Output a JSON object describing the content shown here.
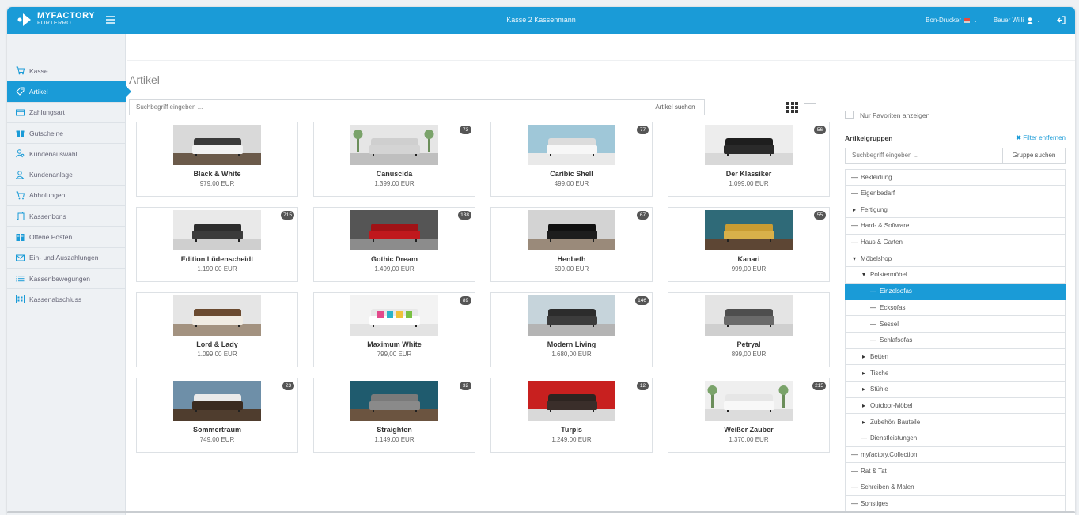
{
  "header": {
    "logo_main": "MYFACTORY",
    "logo_sub": "FORTERRO",
    "title": "Kasse 2 Kassenmann",
    "printer": "Bon-Drucker",
    "user": "Bauer Willi"
  },
  "sidebar": {
    "items": [
      {
        "label": "Kasse",
        "icon": "cart-icon",
        "active": false
      },
      {
        "label": "Artikel",
        "icon": "tag-icon",
        "active": true
      },
      {
        "label": "Zahlungsart",
        "icon": "credit-card-icon",
        "active": false
      },
      {
        "label": "Gutscheine",
        "icon": "gift-icon",
        "active": false
      },
      {
        "label": "Kundenauswahl",
        "icon": "user-search-icon",
        "active": false
      },
      {
        "label": "Kundenanlage",
        "icon": "user-add-icon",
        "active": false
      },
      {
        "label": "Abholungen",
        "icon": "pickup-cart-icon",
        "active": false
      },
      {
        "label": "Kassenbons",
        "icon": "receipt-icon",
        "active": false
      },
      {
        "label": "Offene Posten",
        "icon": "ledger-icon",
        "active": false
      },
      {
        "label": "Ein- und Auszahlungen",
        "icon": "envelope-icon",
        "active": false
      },
      {
        "label": "Kassenbewegungen",
        "icon": "list-icon",
        "active": false
      },
      {
        "label": "Kassenabschluss",
        "icon": "calculator-icon",
        "active": false
      }
    ]
  },
  "main": {
    "title": "Artikel",
    "search_placeholder": "Suchbegriff eingeben ...",
    "search_button": "Artikel suchen"
  },
  "products": [
    {
      "name": "Black & White",
      "price": "979,00 EUR",
      "badge": ""
    },
    {
      "name": "Canuscida",
      "price": "1.399,00 EUR",
      "badge": "73"
    },
    {
      "name": "Caribic Shell",
      "price": "499,00 EUR",
      "badge": "77"
    },
    {
      "name": "Der Klassiker",
      "price": "1.099,00 EUR",
      "badge": "56"
    },
    {
      "name": "Edition Lüdenscheidt",
      "price": "1.199,00 EUR",
      "badge": "715"
    },
    {
      "name": "Gothic Dream",
      "price": "1.499,00 EUR",
      "badge": "138"
    },
    {
      "name": "Henbeth",
      "price": "699,00 EUR",
      "badge": "67"
    },
    {
      "name": "Kanari",
      "price": "999,00 EUR",
      "badge": "55"
    },
    {
      "name": "Lord & Lady",
      "price": "1.099,00 EUR",
      "badge": ""
    },
    {
      "name": "Maximum White",
      "price": "799,00 EUR",
      "badge": "89"
    },
    {
      "name": "Modern Living",
      "price": "1.680,00 EUR",
      "badge": "146"
    },
    {
      "name": "Petryal",
      "price": "899,00 EUR",
      "badge": ""
    },
    {
      "name": "Sommertraum",
      "price": "749,00 EUR",
      "badge": "23"
    },
    {
      "name": "Straighten",
      "price": "1.149,00 EUR",
      "badge": "32"
    },
    {
      "name": "Turpis",
      "price": "1.249,00 EUR",
      "badge": "12"
    },
    {
      "name": "Weißer Zauber",
      "price": "1.370,00 EUR",
      "badge": "215"
    }
  ],
  "right_panel": {
    "favorites_label": "Nur Favoriten anzeigen",
    "groups_title": "Artikelgruppen",
    "filter_remove": "Filter entfernen",
    "group_search_placeholder": "Suchbegriff eingeben ...",
    "group_search_button": "Gruppe suchen",
    "tree": [
      {
        "label": "Bekleidung",
        "level": 0,
        "state": "leaf"
      },
      {
        "label": "Eigenbedarf",
        "level": 0,
        "state": "leaf"
      },
      {
        "label": "Fertigung",
        "level": 0,
        "state": "collapsed"
      },
      {
        "label": "Hard- & Software",
        "level": 0,
        "state": "leaf"
      },
      {
        "label": "Haus & Garten",
        "level": 0,
        "state": "leaf"
      },
      {
        "label": "Möbelshop",
        "level": 0,
        "state": "expanded"
      },
      {
        "label": "Polstermöbel",
        "level": 1,
        "state": "expanded"
      },
      {
        "label": "Einzelsofas",
        "level": 2,
        "state": "leaf",
        "selected": true
      },
      {
        "label": "Ecksofas",
        "level": 2,
        "state": "leaf"
      },
      {
        "label": "Sessel",
        "level": 2,
        "state": "leaf"
      },
      {
        "label": "Schlafsofas",
        "level": 2,
        "state": "leaf"
      },
      {
        "label": "Betten",
        "level": 1,
        "state": "collapsed"
      },
      {
        "label": "Tische",
        "level": 1,
        "state": "collapsed"
      },
      {
        "label": "Stühle",
        "level": 1,
        "state": "collapsed"
      },
      {
        "label": "Outdoor-Möbel",
        "level": 1,
        "state": "collapsed"
      },
      {
        "label": "Zubehör/ Bauteile",
        "level": 1,
        "state": "collapsed"
      },
      {
        "label": "Dienstleistungen",
        "level": 1,
        "state": "leaf"
      },
      {
        "label": "myfactory.Collection",
        "level": 0,
        "state": "leaf"
      },
      {
        "label": "Rat & Tat",
        "level": 0,
        "state": "leaf"
      },
      {
        "label": "Schreiben & Malen",
        "level": 0,
        "state": "leaf"
      },
      {
        "label": "Sonstiges",
        "level": 0,
        "state": "leaf"
      }
    ]
  },
  "colors": {
    "accent": "#1a9bd7",
    "badge": "#555555"
  }
}
